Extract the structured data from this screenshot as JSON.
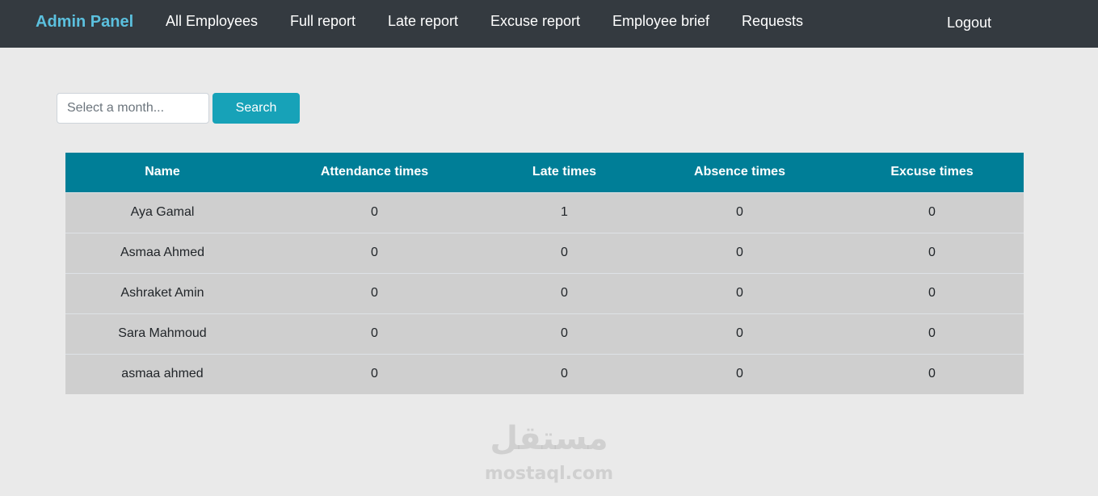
{
  "navbar": {
    "brand": "Admin Panel",
    "links": [
      "All Employees",
      "Full report",
      "Late report",
      "Excuse report",
      "Employee brief",
      "Requests"
    ],
    "logout": "Logout"
  },
  "search": {
    "placeholder": "Select a month...",
    "button_label": "Search"
  },
  "table": {
    "columns": [
      "Name",
      "Attendance times",
      "Late times",
      "Absence times",
      "Excuse times"
    ],
    "rows": [
      [
        "Aya Gamal",
        "0",
        "1",
        "0",
        "0"
      ],
      [
        "Asmaa Ahmed",
        "0",
        "0",
        "0",
        "0"
      ],
      [
        "Ashraket Amin",
        "0",
        "0",
        "0",
        "0"
      ],
      [
        "Sara Mahmoud",
        "0",
        "0",
        "0",
        "0"
      ],
      [
        "asmaa ahmed",
        "0",
        "0",
        "0",
        "0"
      ]
    ]
  },
  "watermark": {
    "arabic": "مستقل",
    "latin": "mostaql.com"
  },
  "colors": {
    "navbar_bg": "#343a40",
    "brand": "#5bc0de",
    "table_header": "#007e97",
    "search_button": "#17a2b8",
    "row_bg": "#cfcfcf",
    "page_bg": "#eaeaea"
  }
}
